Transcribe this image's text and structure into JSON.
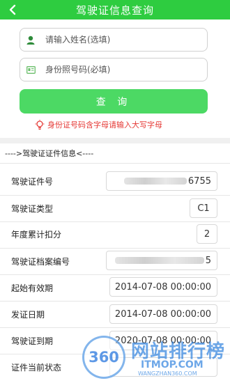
{
  "header": {
    "title": "驾驶证信息查询"
  },
  "form": {
    "name_placeholder": "请输入姓名(选填)",
    "id_placeholder": "身份照号码(必填)",
    "query_label": "查 询",
    "hint": "身份证号码含字母请输入大写字母"
  },
  "section": {
    "title": "---->驾驶证证件信息<----"
  },
  "rows": [
    {
      "label": "驾驶证件号",
      "value": "6755"
    },
    {
      "label": "驾驶证类型",
      "value": "C1"
    },
    {
      "label": "年度累计扣分",
      "value": "2"
    },
    {
      "label": "驾驶证档案编号",
      "value": "5"
    },
    {
      "label": "起始有效期",
      "value": "2014-07-08 00:00:00"
    },
    {
      "label": "发证日期",
      "value": "2014-07-08 00:00:00"
    },
    {
      "label": "驾驶证到期",
      "value": "2020-07-08 00:00:00"
    },
    {
      "label": "证件当前状态",
      "value": ""
    }
  ],
  "watermark": {
    "badge": "360",
    "line1": "网站排行榜",
    "line2": "ITMOP.COM",
    "line3": "WANGZHAN360.COM"
  },
  "colors": {
    "header": "#2ecc40",
    "button": "#4cd964",
    "hint": "#e53935"
  },
  "icons": {
    "back": "chevron-left-icon",
    "user": "person-icon",
    "id": "id-card-icon",
    "hint": "lightbulb-icon"
  }
}
